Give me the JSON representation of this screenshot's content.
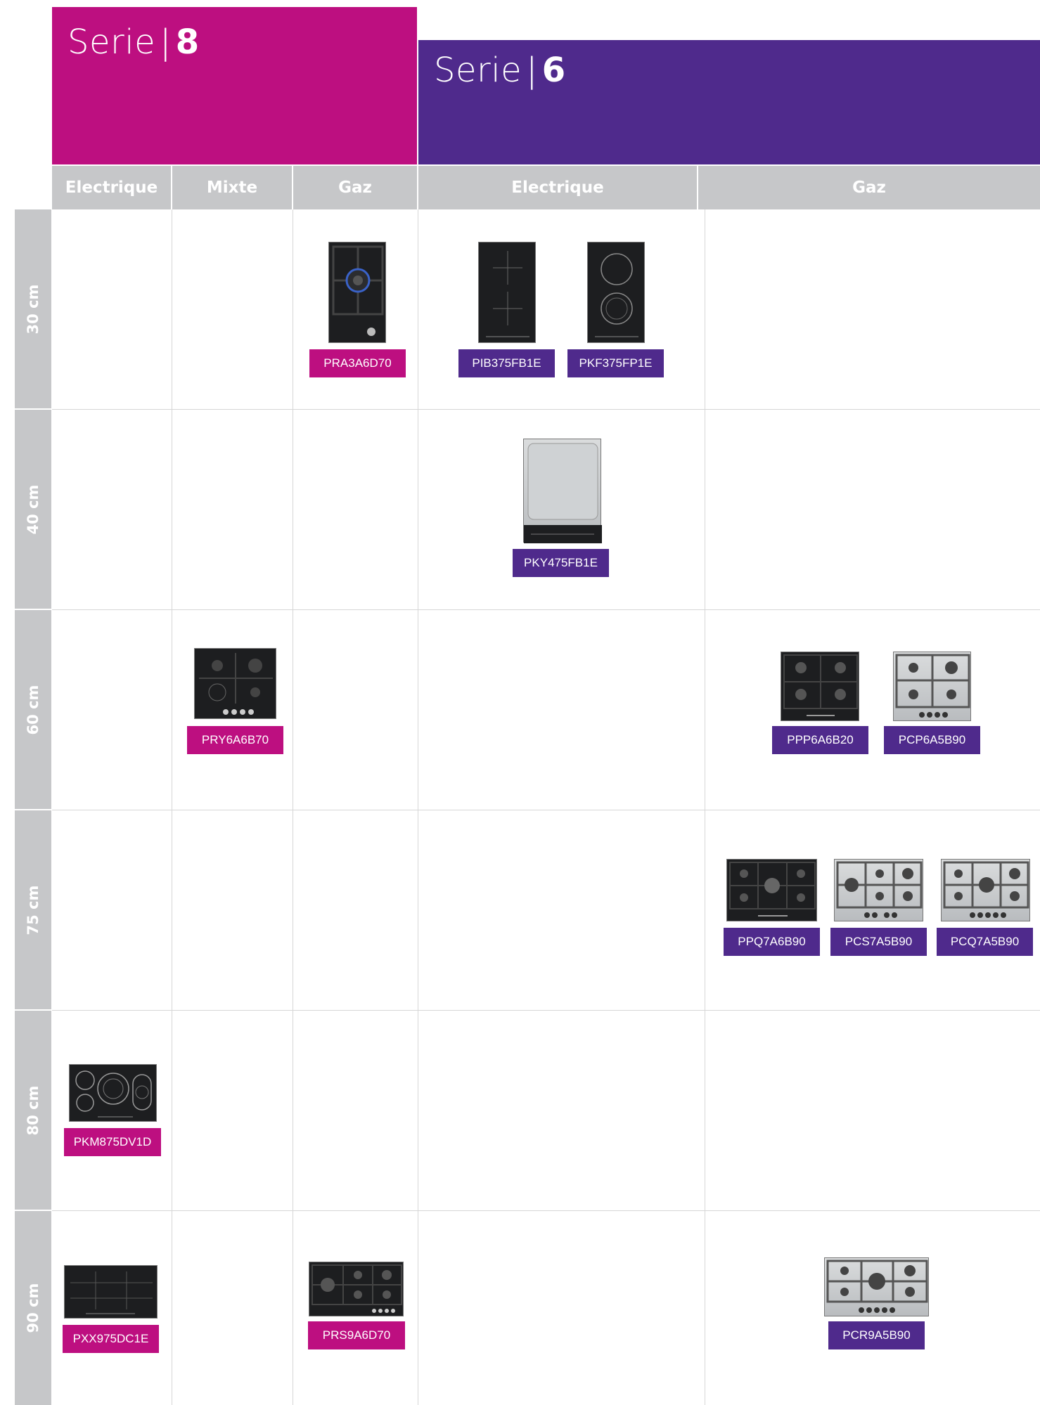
{
  "series": [
    {
      "prefix": "Serie",
      "number": "8",
      "color": "#bd0f80"
    },
    {
      "prefix": "Serie",
      "number": "6",
      "color": "#4f2a8c"
    }
  ],
  "columns": [
    "Electrique",
    "Mixte",
    "Gaz",
    "Electrique",
    "Gaz"
  ],
  "rows": [
    "30 cm",
    "40 cm",
    "60 cm",
    "75 cm",
    "80 cm",
    "90 cm"
  ],
  "products": [
    {
      "code": "PRA3A6D70",
      "serie": "8",
      "width": "30 cm",
      "type": "Gaz",
      "icon": "gas-domino-hob-icon"
    },
    {
      "code": "PIB375FB1E",
      "serie": "6",
      "width": "30 cm",
      "type": "Electrique",
      "icon": "induction-domino-hob-icon"
    },
    {
      "code": "PKF375FP1E",
      "serie": "6",
      "width": "30 cm",
      "type": "Electrique",
      "icon": "ceramic-domino-hob-icon"
    },
    {
      "code": "PKY475FB1E",
      "serie": "6",
      "width": "40 cm",
      "type": "Electrique",
      "icon": "teppanyaki-hob-icon"
    },
    {
      "code": "PRY6A6B70",
      "serie": "8",
      "width": "60 cm",
      "type": "Mixte",
      "icon": "mixed-hob-icon"
    },
    {
      "code": "PPP6A6B20",
      "serie": "6",
      "width": "60 cm",
      "type": "Gaz",
      "icon": "gas-hob-black-icon"
    },
    {
      "code": "PCP6A5B90",
      "serie": "6",
      "width": "60 cm",
      "type": "Gaz",
      "icon": "gas-hob-steel-icon"
    },
    {
      "code": "PPQ7A6B90",
      "serie": "6",
      "width": "75 cm",
      "type": "Gaz",
      "icon": "gas-hob-black-icon"
    },
    {
      "code": "PCS7A5B90",
      "serie": "6",
      "width": "75 cm",
      "type": "Gaz",
      "icon": "gas-hob-steel-icon"
    },
    {
      "code": "PCQ7A5B90",
      "serie": "6",
      "width": "75 cm",
      "type": "Gaz",
      "icon": "gas-hob-steel-icon"
    },
    {
      "code": "PKM875DV1D",
      "serie": "8",
      "width": "80 cm",
      "type": "Electrique",
      "icon": "ceramic-hob-icon"
    },
    {
      "code": "PXX975DC1E",
      "serie": "8",
      "width": "90 cm",
      "type": "Electrique",
      "icon": "induction-hob-icon"
    },
    {
      "code": "PRS9A6D70",
      "serie": "8",
      "width": "90 cm",
      "type": "Gaz",
      "icon": "gas-hob-black-icon"
    },
    {
      "code": "PCR9A5B90",
      "serie": "6",
      "width": "90 cm",
      "type": "Gaz",
      "icon": "gas-hob-steel-icon"
    }
  ]
}
